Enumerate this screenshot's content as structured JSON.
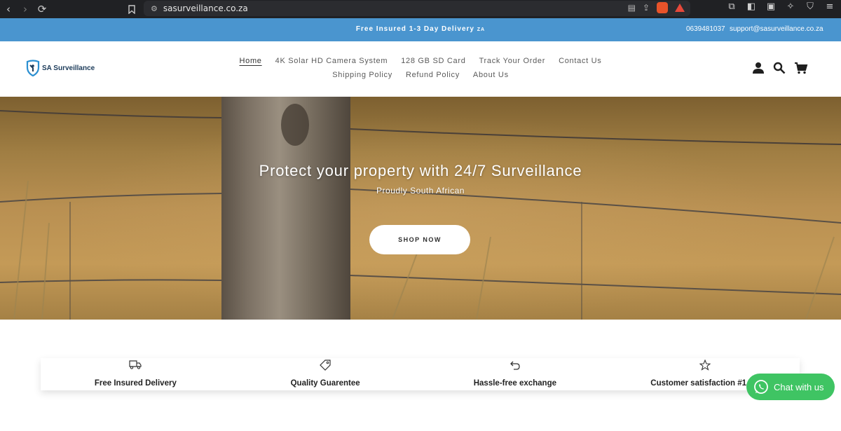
{
  "browser": {
    "url": "sasurveillance.co.za",
    "nav_icons": [
      "back-icon",
      "forward-icon",
      "reload-icon",
      "bookmark-icon"
    ],
    "badge_count": "8"
  },
  "announcement": {
    "message": "Free Insured 1-3 Day Delivery",
    "country_code": "ZA",
    "phone": "0639481037",
    "email": "support@sasurveillance.co.za"
  },
  "header": {
    "logo_text": "SA Surveillance",
    "nav_row1": [
      "Home",
      "4K Solar HD Camera System",
      "128 GB SD Card",
      "Track Your Order",
      "Contact Us"
    ],
    "nav_row2": [
      "Shipping Policy",
      "Refund Policy",
      "About Us"
    ],
    "icons": [
      "account-icon",
      "search-icon",
      "cart-icon"
    ]
  },
  "hero": {
    "title": "Protect your property with 24/7 Surveillance",
    "subtitle": "Proudly South African",
    "button": "SHOP NOW"
  },
  "features": [
    {
      "icon": "truck-icon",
      "label": "Free Insured Delivery"
    },
    {
      "icon": "tag-icon",
      "label": "Quality Guarentee"
    },
    {
      "icon": "return-arrow-icon",
      "label": "Hassle-free exchange"
    },
    {
      "icon": "star-icon",
      "label": "Customer satisfaction #1 pri"
    }
  ],
  "chat": {
    "label": "Chat with us",
    "color": "#3fc463"
  },
  "colors": {
    "announcement_bg": "#4a95cf",
    "chrome_bg": "#202124"
  }
}
